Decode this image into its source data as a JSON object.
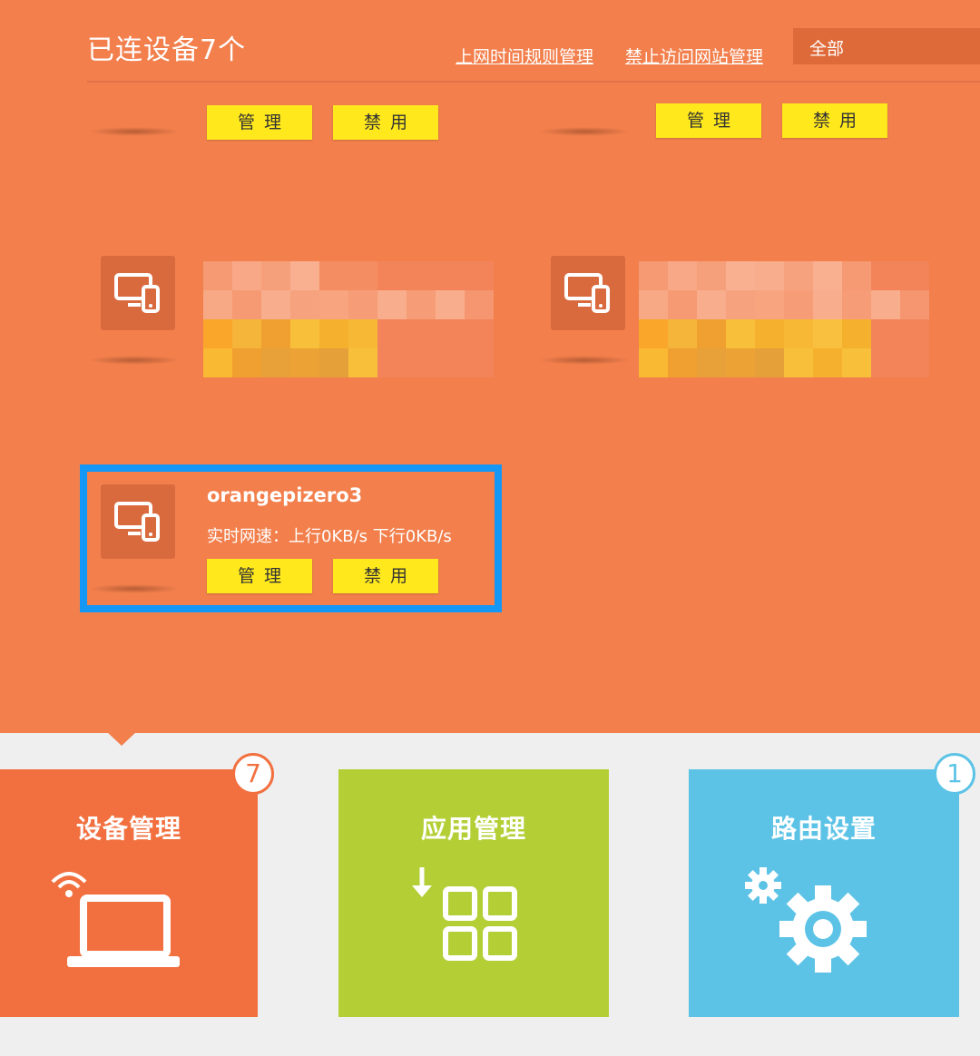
{
  "header": {
    "title": "已连设备7个",
    "link_schedule": "上网时间规则管理",
    "link_block_sites": "禁止访问网站管理",
    "filter_value": "全部"
  },
  "devices": [
    {
      "manage_label": "管理",
      "disable_label": "禁用"
    },
    {
      "manage_label": "管理",
      "disable_label": "禁用"
    },
    {
      "icon": "device-icon",
      "name_hidden": true
    },
    {
      "icon": "device-icon",
      "name_hidden": true
    },
    {
      "icon": "device-icon",
      "name": "orangepizero3",
      "speed_text": "实时网速：上行0KB/s  下行0KB/s",
      "manage_label": "管理",
      "disable_label": "禁用",
      "highlighted": true
    }
  ],
  "nav_tiles": [
    {
      "label": "设备管理",
      "badge": "7",
      "icon": "laptop-wifi-icon",
      "color": "#f2703f",
      "active": true
    },
    {
      "label": "应用管理",
      "badge": "",
      "icon": "apps-download-icon",
      "color": "#b3cf35"
    },
    {
      "label": "路由设置",
      "badge": "1",
      "icon": "gears-icon",
      "color": "#5dc3e6"
    }
  ],
  "colors": {
    "background_top": "#f27f4c",
    "button": "#ffe81c",
    "highlight_border": "#1597f5"
  }
}
